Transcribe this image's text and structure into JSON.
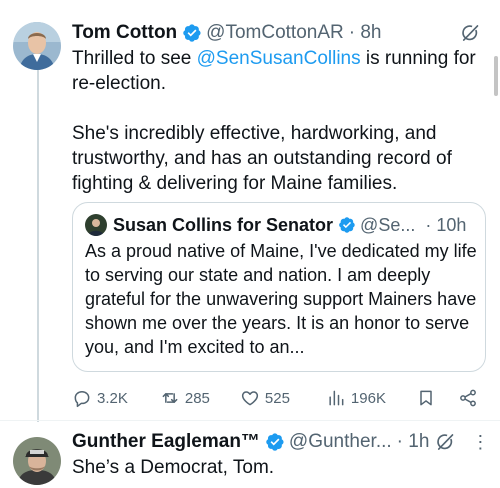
{
  "tweets": [
    {
      "author": "Tom Cotton",
      "handle": "@TomCottonAR",
      "time": "· 8h",
      "text_intro": "Thrilled to see ",
      "mention": "@SenSusanCollins",
      "text_after_mention": " is running for re-election.",
      "text_p2": "She's incredibly effective, hardworking, and trustworthy, and has an outstanding record of fighting & delivering for Maine families.",
      "quote": {
        "author": "Susan Collins for Senator",
        "handle": "@Se...",
        "time": "· 10h",
        "text": "As a proud native of Maine, I've dedicated my life to serving our state and nation. I am deeply grateful for the unwavering support Mainers have shown me over the years. It is an honor to serve you, and I'm excited to an..."
      },
      "stats": {
        "replies": "3.2K",
        "reposts": "285",
        "likes": "525",
        "views": "196K"
      }
    },
    {
      "author": "Gunther Eagleman™",
      "handle": "@Gunther...",
      "time": "· 1h",
      "text": "She’s a Democrat, Tom."
    }
  ],
  "icons": {
    "verified": "verified-badge-icon",
    "grok": "grok-icon",
    "more": "more-icon",
    "reply": "reply-icon",
    "repost": "repost-icon",
    "like": "heart-icon",
    "views": "views-icon",
    "bookmark": "bookmark-icon",
    "share": "share-icon"
  },
  "colors": {
    "link": "#1d9bf0",
    "verified": "#1d9bf0",
    "secondary_text": "#536471",
    "border": "#cfd9de"
  }
}
